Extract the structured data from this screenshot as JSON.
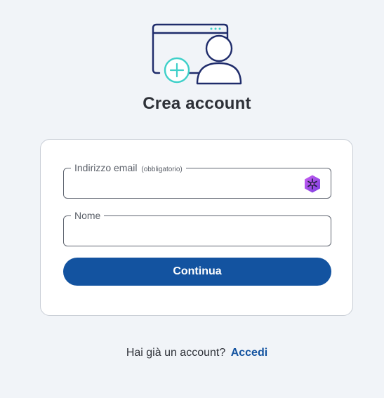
{
  "header": {
    "illustration_icon": "create-account-window-user-plus-icon",
    "title": "Crea account"
  },
  "form": {
    "email": {
      "label": "Indirizzo email",
      "required_hint": "(obbligatorio)",
      "value": "",
      "autofill_icon": "password-manager-icon"
    },
    "name": {
      "label": "Nome",
      "value": ""
    },
    "continue_label": "Continua"
  },
  "footer": {
    "prompt": "Hai già un account?",
    "signin_link": "Accedi"
  },
  "colors": {
    "background": "#f1f4f8",
    "primary": "#1353a0",
    "illustration_navy": "#1f2c6b",
    "illustration_teal": "#3fd0c9",
    "card_border": "#c9ced6",
    "text": "#2e3138"
  }
}
